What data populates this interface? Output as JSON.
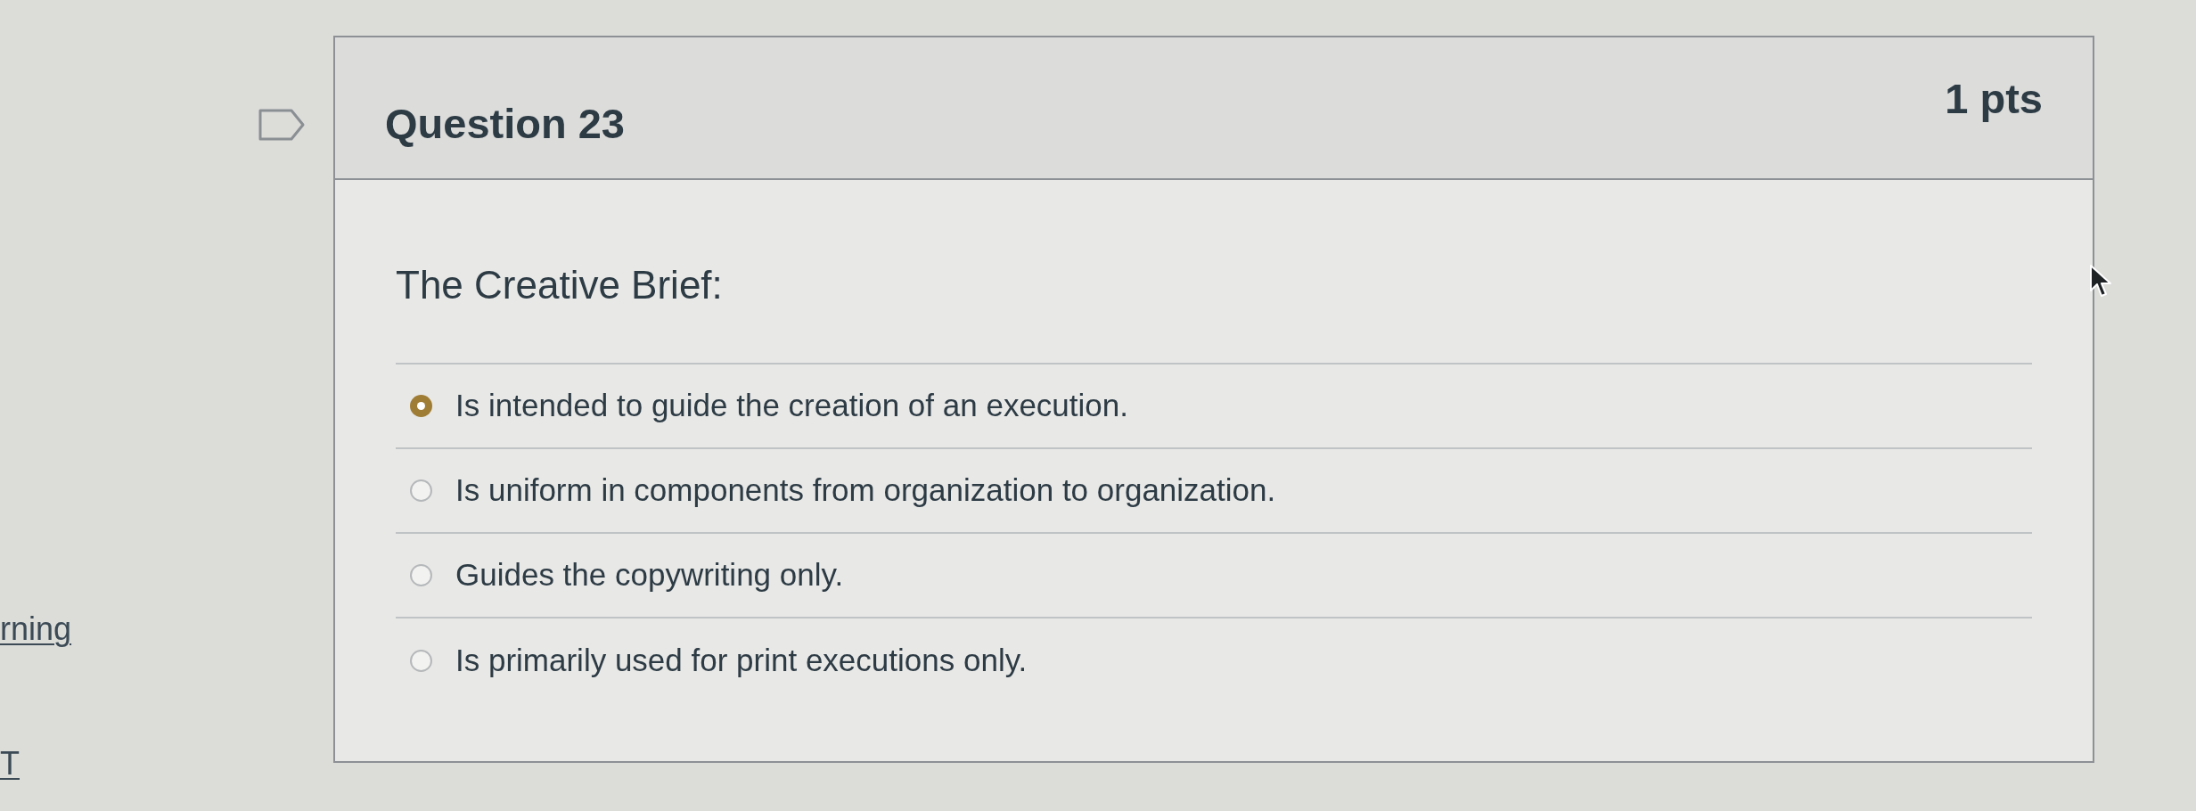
{
  "sidebar": {
    "links": [
      "rning",
      "T"
    ]
  },
  "question": {
    "flagged": false,
    "title": "Question 23",
    "points": "1 pts",
    "text": "The Creative Brief:",
    "answers": [
      {
        "label": "Is intended to guide the creation of an execution.",
        "selected": true
      },
      {
        "label": "Is uniform in components from organization to organization.",
        "selected": false
      },
      {
        "label": "Guides the copywriting only.",
        "selected": false
      },
      {
        "label": "Is primarily used for print executions only.",
        "selected": false
      }
    ]
  }
}
